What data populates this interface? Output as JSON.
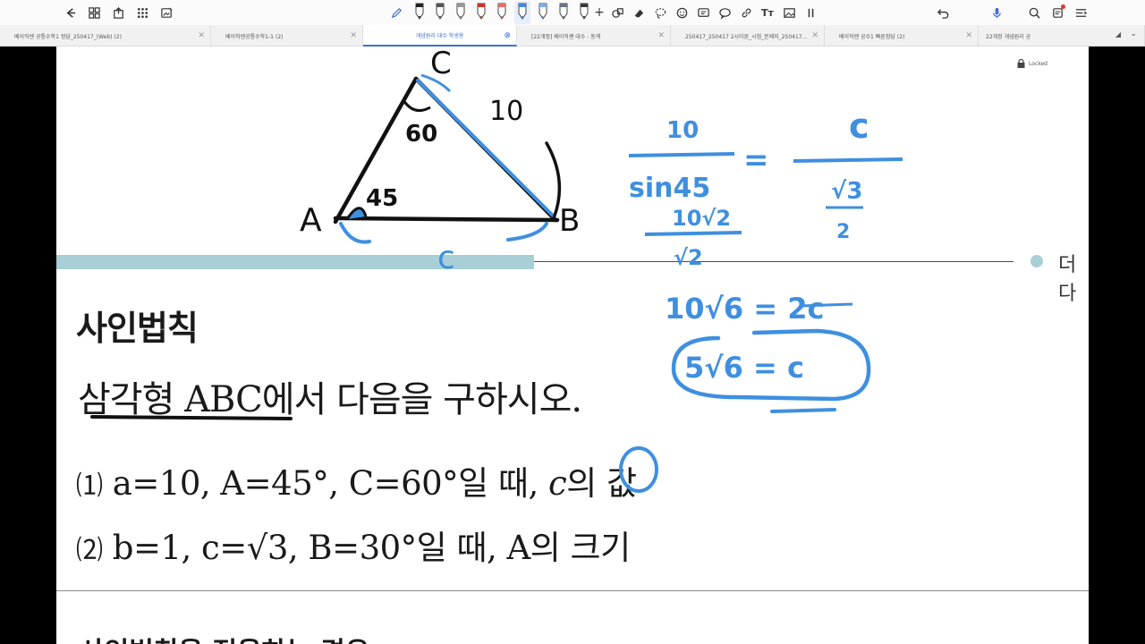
{
  "toolbar": {
    "left_icons": [
      "back-icon",
      "grid-icon",
      "share-icon",
      "apps-icon",
      "edit-image-icon"
    ],
    "right_icons": [
      "undo-icon",
      "mic-icon",
      "search-icon",
      "bell-icon",
      "menu-icon"
    ],
    "pen_count": 9,
    "active_pen": 5,
    "pen_colors": [
      "#222222",
      "#555555",
      "#999999",
      "#c8362e",
      "#e46f6b",
      "#3d8be0",
      "#7aaee8",
      "#6b7280",
      "#3a3a3a"
    ]
  },
  "tabs": [
    {
      "label": "베이직쎈 공통수학1 정답_250417_(Web) (2)"
    },
    {
      "label": "베이직쎈공통수학1-1 (2)"
    },
    {
      "label": "개념원리 대수 학생용",
      "active": true
    },
    {
      "label": "[22개정] 베이직쎈 대수 - 동계"
    },
    {
      "label": "250417_250417 2시이른_시험_문제지_250417..."
    },
    {
      "label": "베이직쎈 공수1 빠른정답 (2)"
    },
    {
      "label": "22개정 개념원리 공"
    }
  ],
  "lock_label": "Locked",
  "page": {
    "more_label": "더 다",
    "heading": "사인법칙",
    "problem": "삼각형 ABC에서 다음을 구하시오.",
    "item1": {
      "num": "⑴",
      "text1": "a=10, A=45°, C=60°일 때, ",
      "var": "c",
      "text2": "의 값"
    },
    "item2": {
      "num": "⑵",
      "text": "b=1, c=√3, B=30°일 때, A의 크기"
    },
    "next_heading": "사인법칙을 적용하는 경우"
  },
  "ink": {
    "black_color": "#111111",
    "blue_color": "#3f8fe0",
    "labels": {
      "C": "C",
      "A": "A",
      "B": "B",
      "ang_c": "60",
      "ang_a": "45",
      "side_a": "10",
      "side_c": "c"
    },
    "work": {
      "line1_num_left": "10",
      "line1_den_left": "sin45",
      "line1_eq": "=",
      "line1_num_right": "c",
      "line1_den_right_num": "√3",
      "line1_den_right_den": "2",
      "line2_num": "10√2",
      "line2_den": "√2",
      "line3": "10√6 = 2c",
      "answer": "5√6 = c"
    }
  }
}
